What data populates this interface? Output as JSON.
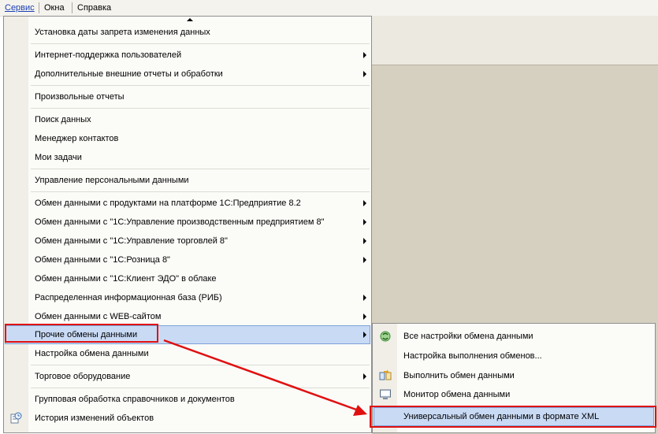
{
  "menubar": {
    "items": [
      {
        "label": "Сервис",
        "active": true
      },
      {
        "label": "Окна",
        "active": false
      },
      {
        "label": "Справка",
        "active": false
      }
    ]
  },
  "service_menu": {
    "items": [
      {
        "label": "Установка даты запрета изменения данных",
        "submenu": false
      },
      {
        "label": "Интернет-поддержка пользователей",
        "submenu": true
      },
      {
        "label": "Дополнительные внешние отчеты и обработки",
        "submenu": true
      },
      {
        "label": "Произвольные отчеты",
        "submenu": false
      },
      {
        "label": "Поиск данных",
        "submenu": false
      },
      {
        "label": "Менеджер контактов",
        "submenu": false
      },
      {
        "label": "Мои задачи",
        "submenu": false
      },
      {
        "label": "Управление персональными данными",
        "submenu": false
      },
      {
        "label": "Обмен данными с продуктами на платформе 1С:Предприятие 8.2",
        "submenu": true
      },
      {
        "label": "Обмен данными с \"1С:Управление производственным предприятием 8\"",
        "submenu": true
      },
      {
        "label": "Обмен данными с \"1С:Управление торговлей 8\"",
        "submenu": true
      },
      {
        "label": "Обмен данными с \"1С:Розница 8\"",
        "submenu": true
      },
      {
        "label": "Обмен данными с \"1С:Клиент ЭДО\" в облаке",
        "submenu": false
      },
      {
        "label": "Распределенная информационная база (РИБ)",
        "submenu": true
      },
      {
        "label": "Обмен данными с WEB-сайтом",
        "submenu": true
      },
      {
        "label": "Прочие обмены данными",
        "submenu": true,
        "highlighted": true
      },
      {
        "label": "Настройка обмена данными",
        "submenu": false
      },
      {
        "label": "Торговое оборудование",
        "submenu": true
      },
      {
        "label": "Групповая обработка справочников и документов",
        "submenu": false
      },
      {
        "label": "История изменений объектов",
        "submenu": false,
        "icon": "history-icon"
      }
    ]
  },
  "other_exchanges_submenu": {
    "items": [
      {
        "label": "Все настройки обмена данными",
        "icon": "exchange-settings-icon"
      },
      {
        "label": "Настройка выполнения обменов...",
        "icon": ""
      },
      {
        "label": "Выполнить обмен данными",
        "icon": "run-exchange-icon"
      },
      {
        "label": "Монитор обмена данными",
        "icon": "monitor-icon"
      },
      {
        "label": "Универсальный обмен данными в формате XML",
        "icon": "",
        "highlighted": true
      }
    ]
  },
  "annotation": {
    "color": "#e01010"
  }
}
